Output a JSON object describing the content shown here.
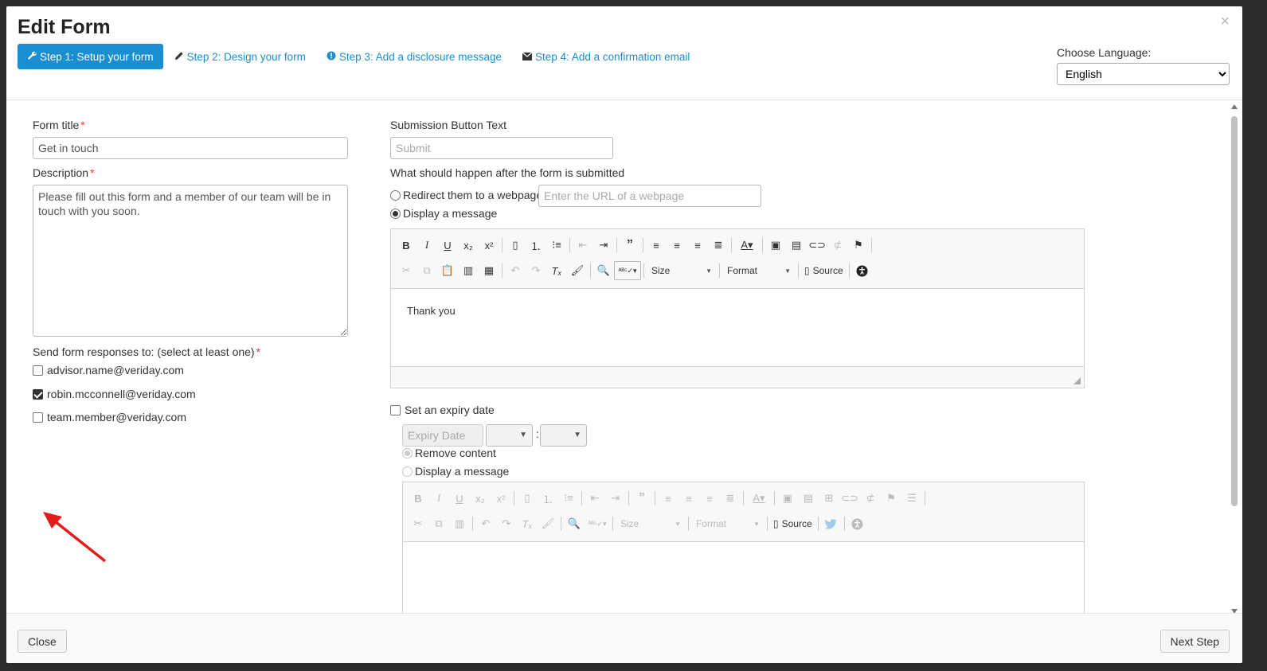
{
  "modal": {
    "title": "Edit Form",
    "close_glyph": "×"
  },
  "steps": [
    {
      "label": "Step 1: Setup your form",
      "icon": "wrench-icon"
    },
    {
      "label": "Step 2: Design your form",
      "icon": "pencil-icon"
    },
    {
      "label": "Step 3: Add a disclosure message",
      "icon": "info-circle-icon"
    },
    {
      "label": "Step 4: Add a confirmation email",
      "icon": "envelope-icon"
    }
  ],
  "language": {
    "label": "Choose Language:",
    "selected": "English"
  },
  "form": {
    "title_label": "Form title",
    "title_value": "Get in touch",
    "description_label": "Description",
    "description_value": "Please fill out this form and a member of our team will be in touch with you soon.",
    "responses_label": "Send form responses to: (select at least one)",
    "required_mark": "*",
    "recipients": [
      {
        "email": "advisor.name@veriday.com",
        "checked": false
      },
      {
        "email": "robin.mcconnell@veriday.com",
        "checked": true
      },
      {
        "email": "team.member@veriday.com",
        "checked": false
      }
    ]
  },
  "submission": {
    "button_text_label": "Submission Button Text",
    "button_text_placeholder": "Submit",
    "after_submit_label": "What should happen after the form is submitted",
    "redirect_label": "Redirect them to a webpage",
    "redirect_placeholder": "Enter the URL of a webpage",
    "display_message_label": "Display a message",
    "selected_option": "display_message",
    "message_content": "Thank you"
  },
  "editor_toolbar": {
    "size_label": "Size",
    "format_label": "Format",
    "source_label": "Source"
  },
  "expiry": {
    "checkbox_label": "Set an expiry date",
    "checked": false,
    "date_placeholder": "Expiry Date",
    "time_separator": ":",
    "remove_content_label": "Remove content",
    "display_message_label": "Display a message"
  },
  "footer": {
    "close_label": "Close",
    "next_label": "Next Step"
  },
  "colors": {
    "accent": "#1a8ed1",
    "required": "#ee3333",
    "annotation_arrow": "#e31b1b"
  }
}
